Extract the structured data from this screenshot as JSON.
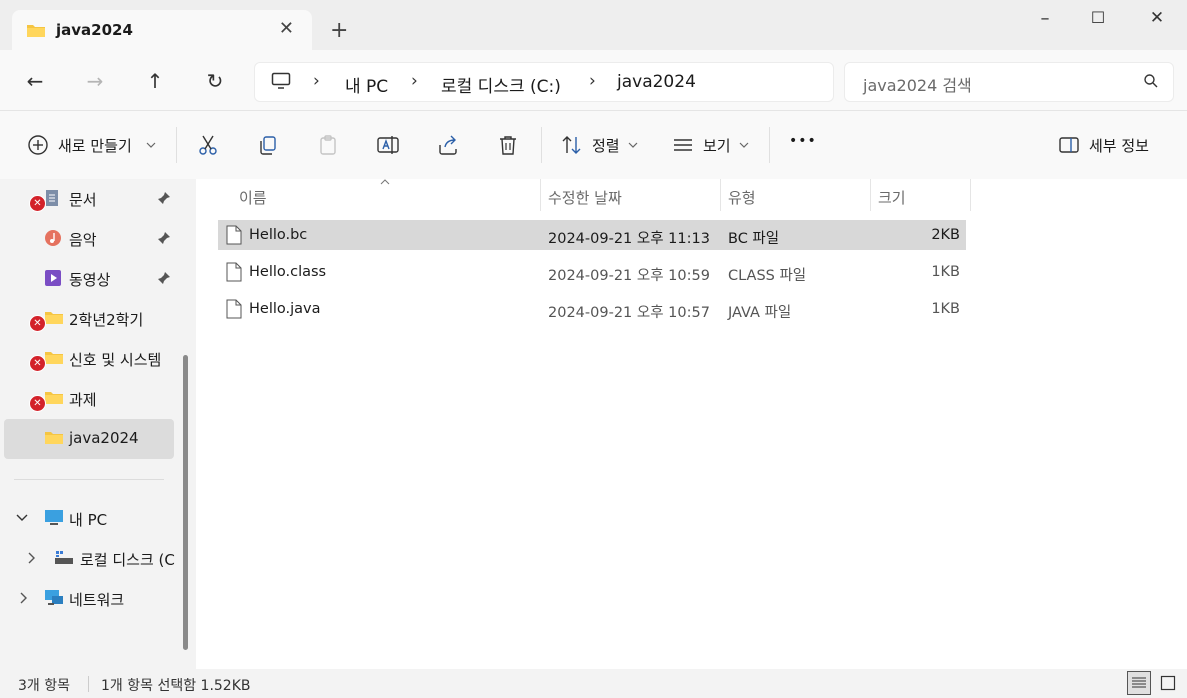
{
  "tab": {
    "title": "java2024",
    "close_glyph": "✕",
    "new_tab_glyph": "+"
  },
  "window_controls": {
    "minimize": "–",
    "maximize": "☐",
    "close": "✕"
  },
  "nav": {
    "back": "←",
    "forward": "→",
    "up": "↑",
    "refresh": "↻"
  },
  "breadcrumb": {
    "items": [
      "내 PC",
      "로컬 디스크 (C:)",
      "java2024"
    ],
    "separator": "›"
  },
  "search": {
    "placeholder": "java2024 검색"
  },
  "toolbar": {
    "new_label": "새로 만들기",
    "sort_label": "정렬",
    "view_label": "보기",
    "more_label": "•••",
    "details_label": "세부 정보"
  },
  "sidebar": {
    "items": [
      {
        "label": "문서",
        "icon": "documents-icon",
        "pinned": true,
        "error": true
      },
      {
        "label": "음악",
        "icon": "music-icon",
        "pinned": true,
        "error": false
      },
      {
        "label": "동영상",
        "icon": "videos-icon",
        "pinned": true,
        "error": false
      },
      {
        "label": "2학년2학기",
        "icon": "folder-icon",
        "pinned": false,
        "error": true
      },
      {
        "label": "신호 및 시스템",
        "icon": "folder-icon",
        "pinned": false,
        "error": true
      },
      {
        "label": "과제",
        "icon": "folder-icon",
        "pinned": false,
        "error": true
      },
      {
        "label": "java2024",
        "icon": "folder-icon",
        "pinned": false,
        "error": false,
        "selected": true
      }
    ],
    "this_pc": "내 PC",
    "local_disk": "로컬 디스크 (C",
    "network": "네트워크"
  },
  "columns": {
    "name": "이름",
    "date": "수정한 날짜",
    "type": "유형",
    "size": "크기"
  },
  "files": [
    {
      "name": "Hello.bc",
      "date": "2024-09-21 오후 11:13",
      "type": "BC 파일",
      "size": "2KB",
      "selected": true
    },
    {
      "name": "Hello.class",
      "date": "2024-09-21 오후 10:59",
      "type": "CLASS 파일",
      "size": "1KB",
      "selected": false
    },
    {
      "name": "Hello.java",
      "date": "2024-09-21 오후 10:57",
      "type": "JAVA 파일",
      "size": "1KB",
      "selected": false
    }
  ],
  "status": {
    "count": "3개 항목",
    "selection": "1개 항목 선택함 1.52KB"
  },
  "colors": {
    "folder": "#f5c542",
    "error": "#d3222a",
    "selection": "#d8d8d8"
  }
}
